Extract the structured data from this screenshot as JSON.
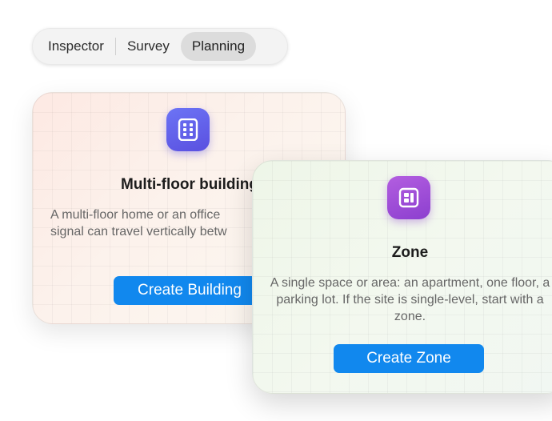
{
  "segmented": {
    "items": [
      {
        "label": "Inspector",
        "active": false
      },
      {
        "label": "Survey",
        "active": false
      },
      {
        "label": "Planning",
        "active": true
      }
    ]
  },
  "cards": {
    "building": {
      "icon": "building-grid-icon",
      "title": "Multi-floor building",
      "desc_line1": "A multi-floor home or an office",
      "desc_line2": "signal can travel vertically betw",
      "button_label": "Create Building",
      "accent": "#5a50e0"
    },
    "zone": {
      "icon": "zone-floorplan-icon",
      "title": "Zone",
      "desc": "A single space or area: an apartment, one floor, a parking lot. If the site is single-level, start with a zone.",
      "button_label": "Create Zone",
      "accent": "#8c3fcf"
    }
  },
  "colors": {
    "button": "#1188ee",
    "active_segment": "#dcdcdc"
  }
}
